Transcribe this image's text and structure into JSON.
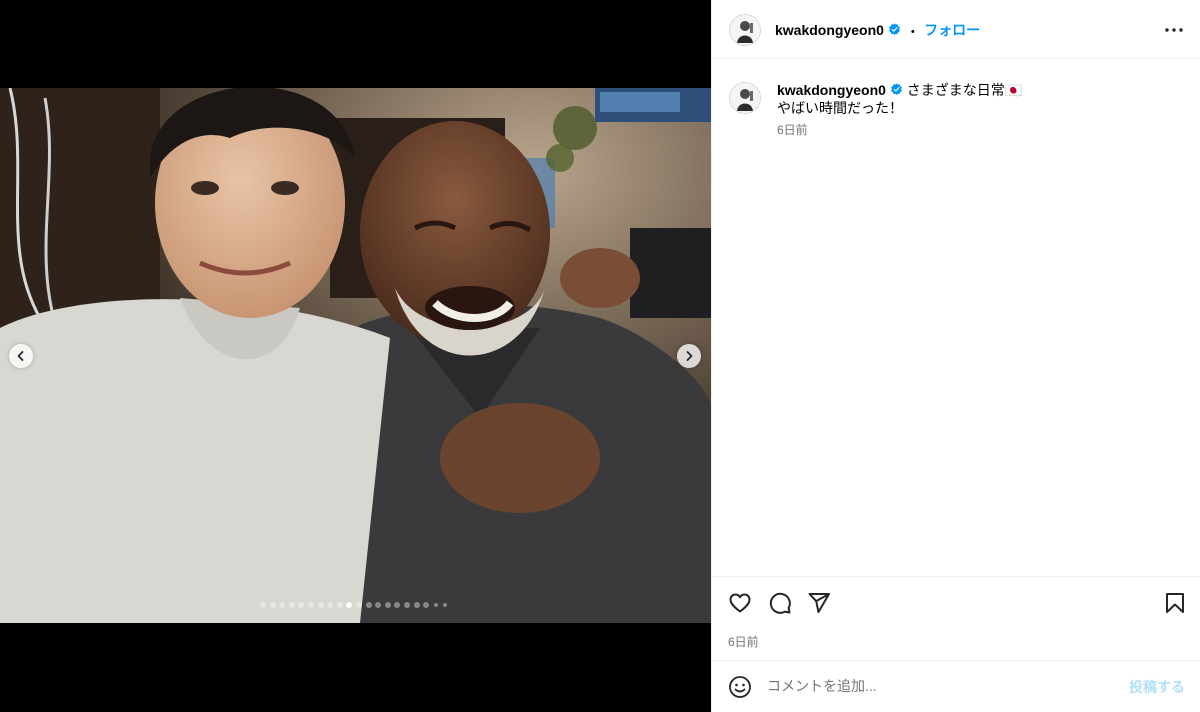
{
  "post": {
    "username": "kwakdongyeon0",
    "follow_label": "フォロー",
    "separator": "•",
    "caption_line1": "さまざまな日常🇯🇵",
    "caption_line2": "やばい時間だった！",
    "caption_time": "6日前",
    "post_time": "6日前"
  },
  "carousel": {
    "total_slides": 20,
    "active_index": 9
  },
  "comment": {
    "placeholder": "コメントを追加...",
    "submit_label": "投稿する"
  },
  "icons": {
    "header_more": "more-horizontal-icon",
    "like": "heart-icon",
    "comment": "comment-icon",
    "share": "send-icon",
    "save": "bookmark-icon",
    "emoji": "emoji-icon",
    "verified": "verified-badge-icon",
    "prev": "chevron-left-icon",
    "next": "chevron-right-icon"
  },
  "colors": {
    "accent": "#0095f6",
    "post_button_disabled": "#b2dffc",
    "muted_text": "#737373"
  }
}
